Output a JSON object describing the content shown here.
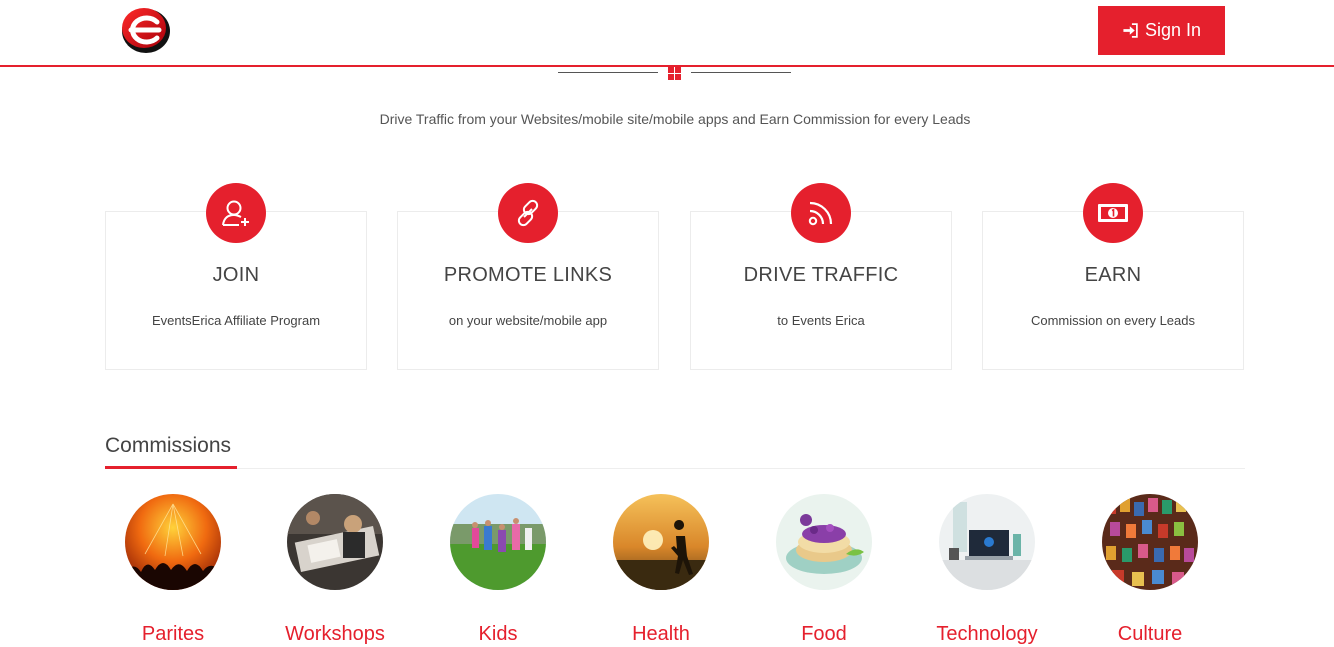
{
  "header": {
    "logo_letter": "e",
    "signin_label": "Sign In"
  },
  "tagline": "Drive Traffic from your Websites/mobile site/mobile apps and Earn Commission for every Leads",
  "steps": [
    {
      "title": "JOIN",
      "desc": "EventsErica Affiliate Program",
      "icon": "add-user-icon"
    },
    {
      "title": "PROMOTE LINKS",
      "desc": "on your website/mobile app",
      "icon": "link-icon"
    },
    {
      "title": "DRIVE TRAFFIC",
      "desc": "to Events Erica",
      "icon": "rss-icon"
    },
    {
      "title": "EARN",
      "desc": "Commission on every Leads",
      "icon": "money-icon"
    }
  ],
  "commissions": {
    "title": "Commissions",
    "categories": [
      {
        "label": "Parites"
      },
      {
        "label": "Workshops"
      },
      {
        "label": "Kids"
      },
      {
        "label": "Health"
      },
      {
        "label": "Food"
      },
      {
        "label": "Technology"
      },
      {
        "label": "Culture"
      }
    ]
  },
  "colors": {
    "accent": "#e5202d",
    "text": "#444444"
  }
}
